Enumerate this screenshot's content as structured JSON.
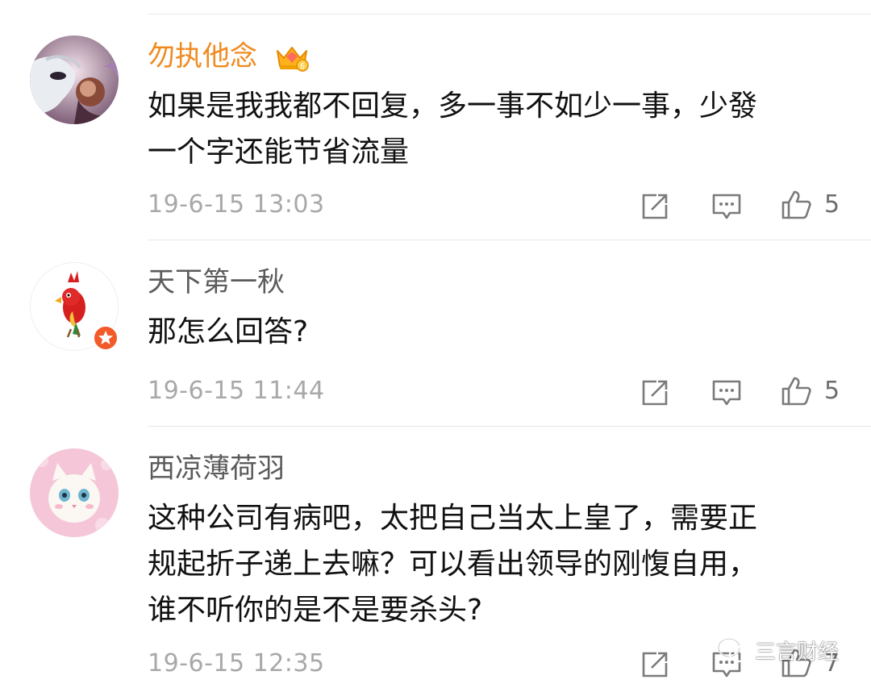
{
  "comments": [
    {
      "username": "勿执他念",
      "vip_level": "6",
      "content_lines": [
        "如果是我我都不回复，多一事不如少一事，少發",
        "一个字还能节省流量"
      ],
      "timestamp": "19-6-15 13:03",
      "likes": "5"
    },
    {
      "username": "天下第一秋",
      "content_lines": [
        "那怎么回答?"
      ],
      "timestamp": "19-6-15 11:44",
      "likes": "5"
    },
    {
      "username": "西凉薄荷羽",
      "content_lines": [
        "这种公司有病吧，太把自己当太上皇了，需要正",
        "规起折子递上去嘛？可以看出领导的刚愎自用，",
        "谁不听你的是不是要杀头?"
      ],
      "timestamp": "19-6-15 12:35",
      "likes": "7"
    }
  ],
  "watermark": {
    "text": "三言财经",
    "icon": "wechat-icon"
  },
  "colors": {
    "vip_name": "#f08a1f",
    "name": "#5b5b5b",
    "meta": "#a8a8a8"
  }
}
